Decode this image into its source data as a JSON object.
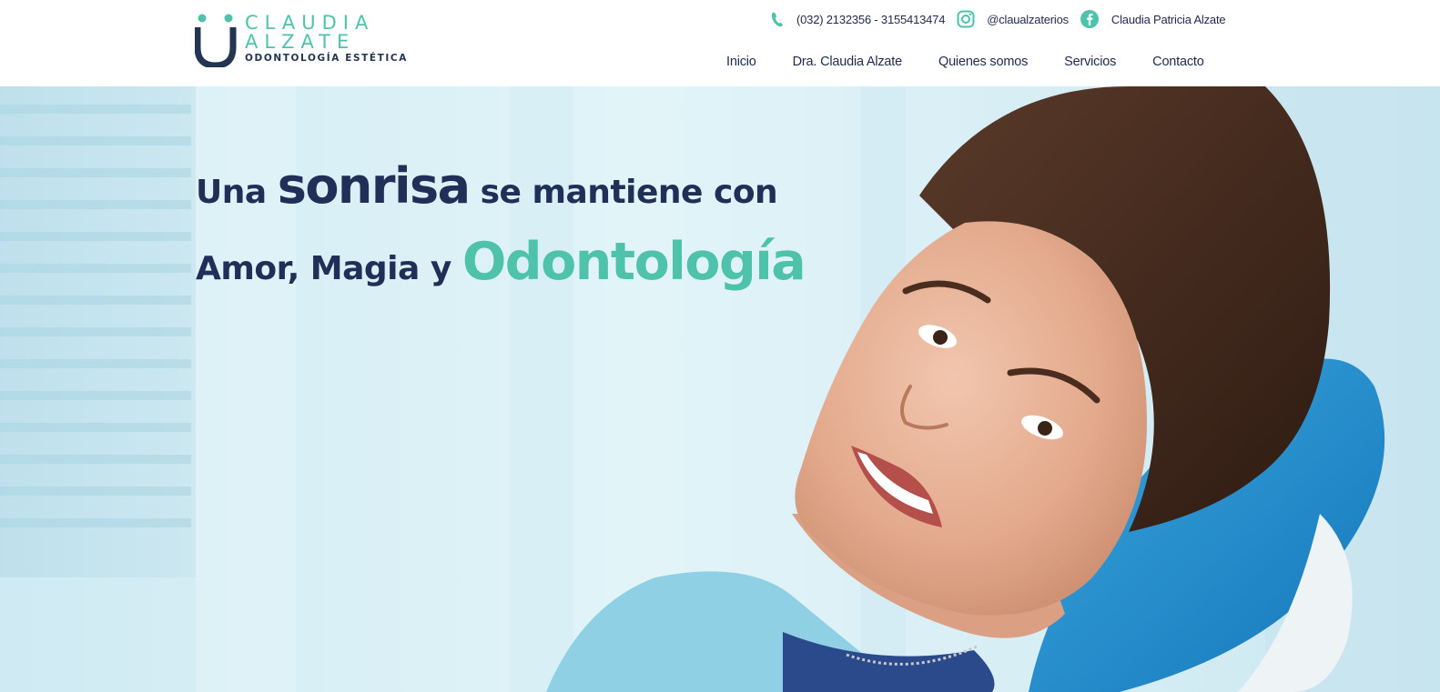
{
  "brand": {
    "line1": "CLAUDIA",
    "line2": "ALZATE",
    "tagline": "ODONTOLOGÍA ESTÉTICA",
    "colors": {
      "teal": "#4ec2ab",
      "navy": "#243552"
    }
  },
  "contact": {
    "phone": "(032) 2132356 - 3155413474",
    "instagram": "@claualzaterios",
    "facebook": "Claudia Patricia Alzate",
    "icons": [
      "phone-icon",
      "instagram-icon",
      "facebook-icon"
    ]
  },
  "nav": {
    "items": [
      {
        "label": "Inicio"
      },
      {
        "label": "Dra. Claudia Alzate"
      },
      {
        "label": "Quienes somos"
      },
      {
        "label": "Servicios"
      },
      {
        "label": "Contacto"
      }
    ]
  },
  "hero": {
    "line1_part1": "Una ",
    "line1_emphasis": "sonrisa",
    "line1_part2": " se mantiene con",
    "line2_part1": "Amor, Magia y ",
    "line2_emphasis": "Odontología",
    "colors": {
      "navy": "#1f2f58",
      "teal": "#4ec2ab"
    }
  }
}
